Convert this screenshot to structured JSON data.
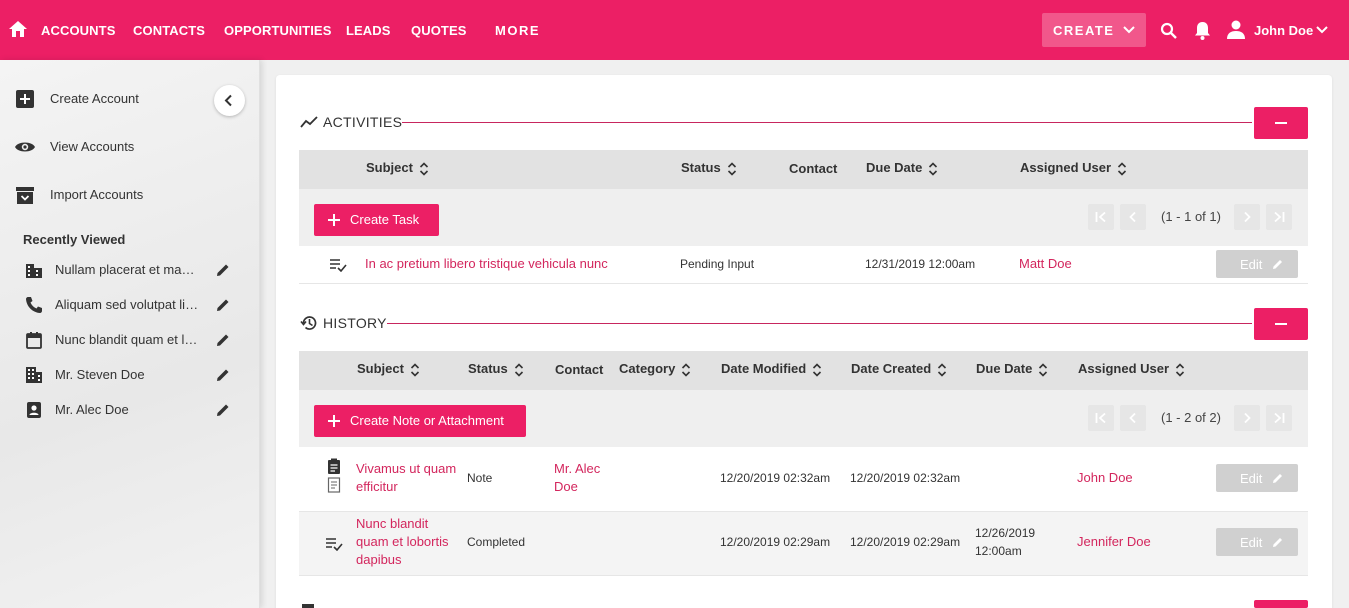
{
  "nav": {
    "links": [
      "ACCOUNTS",
      "CONTACTS",
      "OPPORTUNITIES",
      "LEADS",
      "QUOTES"
    ],
    "more": "MORE",
    "create": "CREATE",
    "user": "John Doe"
  },
  "sidebar": {
    "actions": [
      {
        "label": "Create Account",
        "icon": "plus-box-icon"
      },
      {
        "label": "View Accounts",
        "icon": "eye-icon"
      },
      {
        "label": "Import Accounts",
        "icon": "archive-icon"
      }
    ],
    "recent_title": "Recently Viewed",
    "recent": [
      {
        "label": "Nullam placerat et mauris",
        "icon": "building-icon"
      },
      {
        "label": "Aliquam sed volutpat libero",
        "icon": "phone-icon"
      },
      {
        "label": "Nunc blandit quam et lobortis",
        "icon": "calendar-icon"
      },
      {
        "label": "Mr. Steven Doe",
        "icon": "office-icon"
      },
      {
        "label": "Mr. Alec Doe",
        "icon": "contact-card-icon"
      }
    ]
  },
  "activities": {
    "title": "ACTIVITIES",
    "columns": [
      "Subject",
      "Status",
      "Contact",
      "Due Date",
      "Assigned User"
    ],
    "create_label": "Create Task",
    "pagination": "(1 - 1 of 1)",
    "rows": [
      {
        "subject": "In ac pretium libero tristique vehicula nunc",
        "status": "Pending Input",
        "contact": "",
        "due": "12/31/2019 12:00am",
        "user": "Matt Doe",
        "edit": "Edit"
      }
    ]
  },
  "history": {
    "title": "HISTORY",
    "columns": [
      "Subject",
      "Status",
      "Contact",
      "Category",
      "Date Modified",
      "Date Created",
      "Due Date",
      "Assigned User"
    ],
    "create_label": "Create Note or Attachment",
    "pagination": "(1 - 2 of 2)",
    "rows": [
      {
        "subject_l1": "Vivamus ut quam",
        "subject_l2": "efficitur",
        "status": "Note",
        "contact_l1": "Mr. Alec",
        "contact_l2": "Doe",
        "modified": "12/20/2019 02:32am",
        "created": "12/20/2019 02:32am",
        "due_l1": "",
        "due_l2": "",
        "user": "John Doe",
        "edit": "Edit"
      },
      {
        "subject_l1": "Nunc blandit",
        "subject_l2": "quam et lobortis",
        "subject_l3": "dapibus",
        "status": "Completed",
        "modified": "12/20/2019 02:29am",
        "created": "12/20/2019 02:29am",
        "due_l1": "12/26/2019",
        "due_l2": "12:00am",
        "user": "Jennifer Doe",
        "edit": "Edit"
      }
    ]
  },
  "colors": {
    "brand": "#ec1f65",
    "link": "#d3265d"
  }
}
